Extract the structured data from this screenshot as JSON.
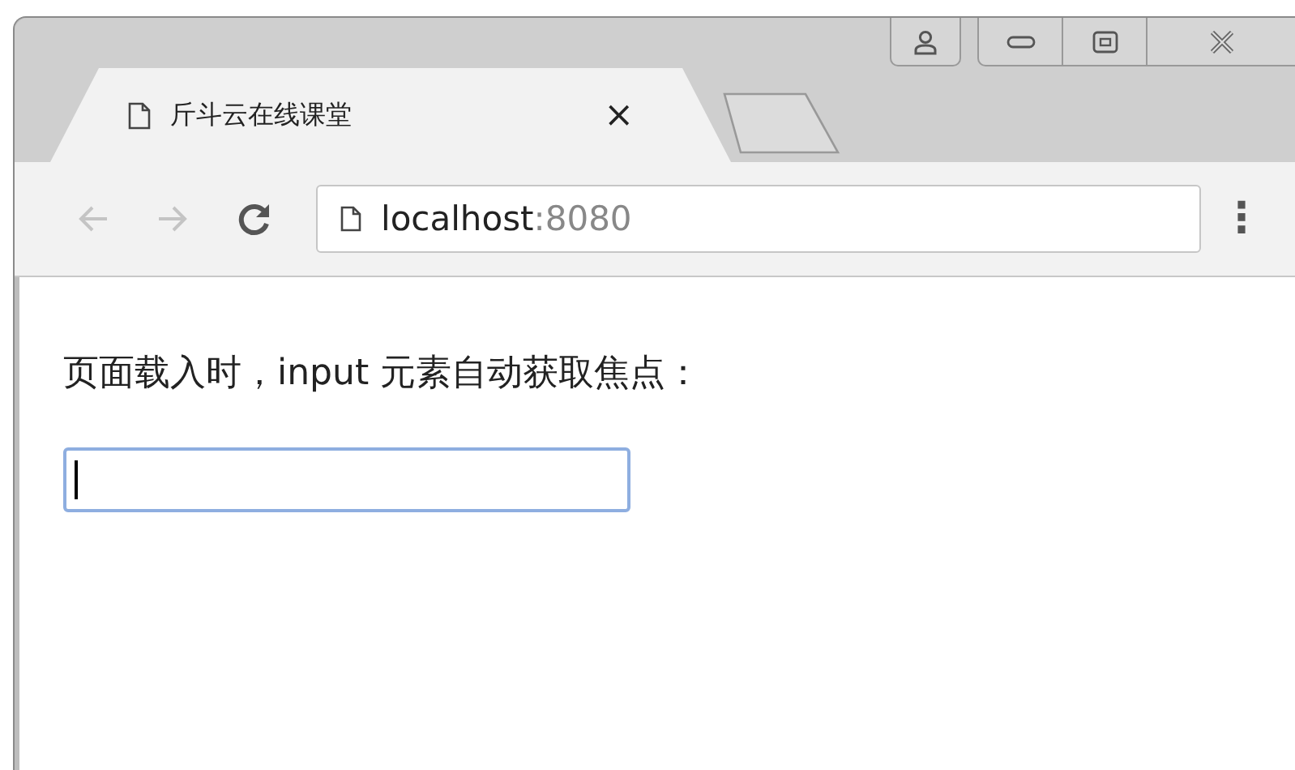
{
  "tabs": [
    {
      "title": "斤斗云在线课堂",
      "close": "×",
      "selected": true
    }
  ],
  "toolbar": {
    "back": {
      "disabled": true
    },
    "forward": {
      "disabled": true
    },
    "menu": "⋮"
  },
  "address": {
    "host": "localhost",
    "port": ":8080"
  },
  "page": {
    "text": "页面载入时，input 元素自动获取焦点：",
    "input": {
      "focused": true
    }
  }
}
